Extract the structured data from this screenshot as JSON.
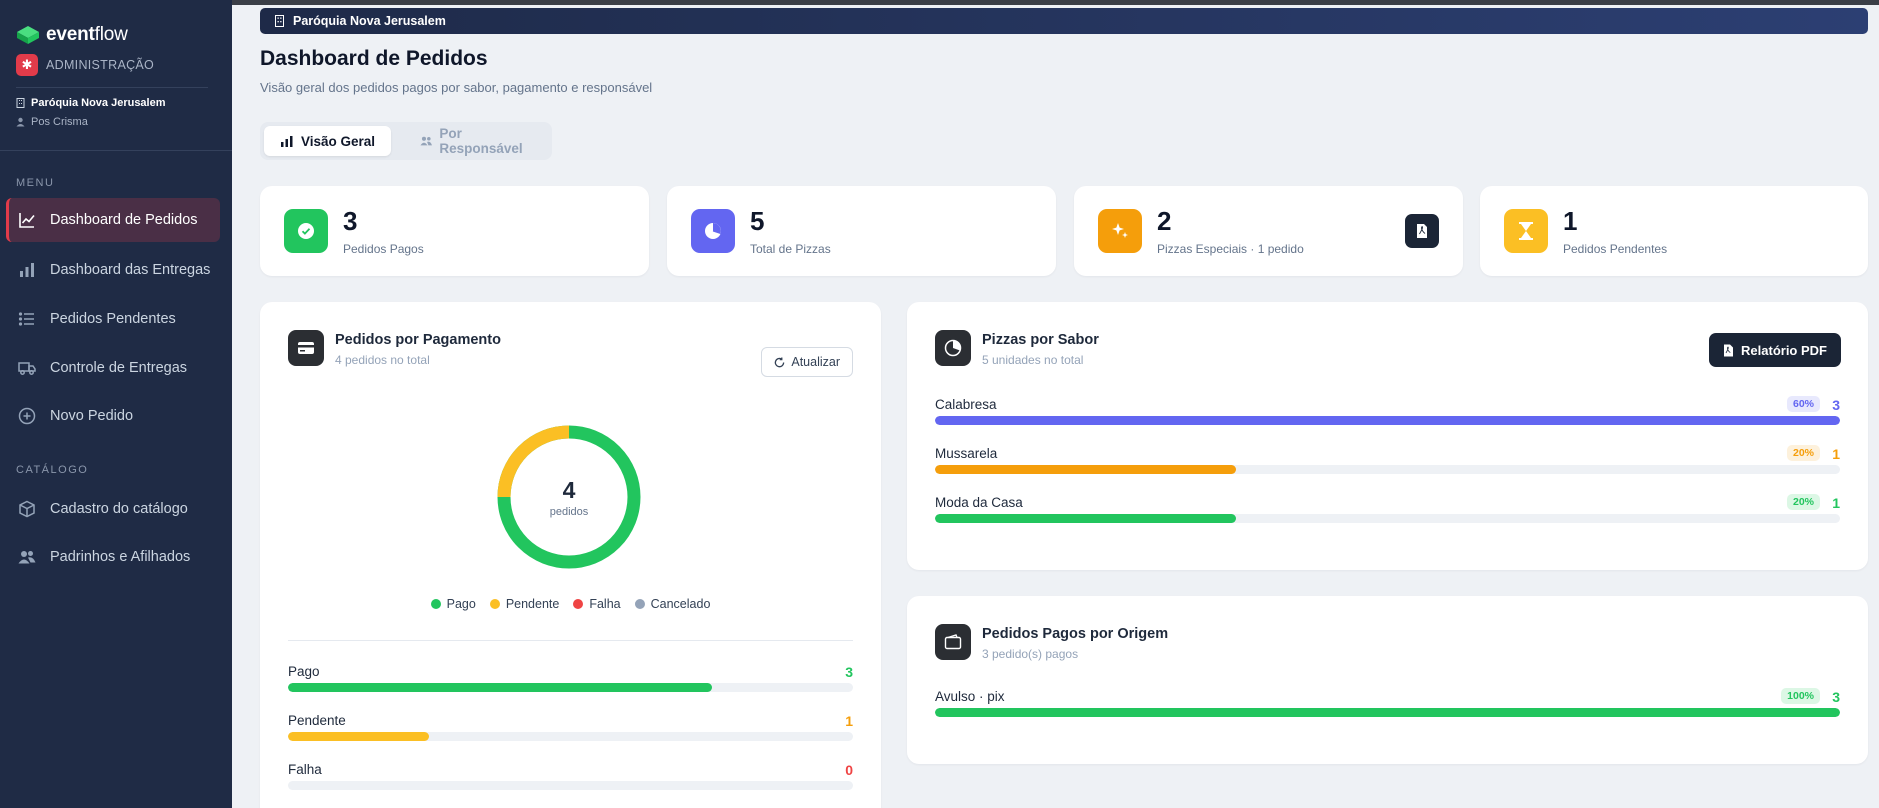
{
  "app": {
    "brand_bold": "event",
    "brand_rest": "flow",
    "admin_label": "ADMINISTRAÇÃO"
  },
  "sidebar": {
    "parish": "Paróquia Nova Jerusalem",
    "group": "Pos Crisma",
    "menu_header": "MENU",
    "catalog_header": "CATÁLOGO",
    "items": [
      {
        "label": "Dashboard de Pedidos",
        "icon": "line-chart-icon",
        "active": true
      },
      {
        "label": "Dashboard das Entregas",
        "icon": "bar-chart-icon"
      },
      {
        "label": "Pedidos Pendentes",
        "icon": "list-icon"
      },
      {
        "label": "Controle de Entregas",
        "icon": "truck-icon"
      },
      {
        "label": "Novo Pedido",
        "icon": "plus-circle-icon"
      }
    ],
    "catalog_items": [
      {
        "label": "Cadastro do catálogo",
        "icon": "box-icon"
      },
      {
        "label": "Padrinhos e Afilhados",
        "icon": "users-icon"
      }
    ]
  },
  "breadcrumb": "Paróquia Nova Jerusalem",
  "page": {
    "title": "Dashboard de Pedidos",
    "subtitle": "Visão geral dos pedidos pagos por sabor, pagamento e responsável"
  },
  "tabs": [
    {
      "label": "Visão Geral",
      "active": true
    },
    {
      "label": "Por Responsável",
      "active": false
    }
  ],
  "stats": [
    {
      "value": "3",
      "label": "Pedidos Pagos",
      "color": "#22c55e",
      "icon": "check-circle-icon"
    },
    {
      "value": "5",
      "label": "Total de Pizzas",
      "color": "#6366f1",
      "icon": "pie-chart-icon"
    },
    {
      "value": "2",
      "label": "Pizzas Especiais · 1 pedido",
      "color": "#f59e0b",
      "icon": "sparkles-icon"
    },
    {
      "value": "1",
      "label": "Pedidos Pendentes",
      "color": "#fbbf24",
      "icon": "hourglass-icon"
    }
  ],
  "payment": {
    "title": "Pedidos por Pagamento",
    "subtitle": "4 pedidos no total",
    "refresh_label": "Atualizar",
    "donut_total": "4",
    "donut_unit": "pedidos",
    "legend": [
      {
        "label": "Pago",
        "color": "#22c55e"
      },
      {
        "label": "Pendente",
        "color": "#fbbf24"
      },
      {
        "label": "Falha",
        "color": "#ef4444"
      },
      {
        "label": "Cancelado",
        "color": "#94a3b8"
      }
    ],
    "rows": [
      {
        "label": "Pago",
        "count": "3",
        "value": 3,
        "color": "#22c55e"
      },
      {
        "label": "Pendente",
        "count": "1",
        "value": 1,
        "color": "#fbbf24",
        "count_color": "#f59e0b"
      },
      {
        "label": "Falha",
        "count": "0",
        "value": 0,
        "color": "#ef4444"
      }
    ],
    "max": 4
  },
  "flavors": {
    "title": "Pizzas por Sabor",
    "subtitle": "5 unidades no total",
    "pdf_label": "Relatório PDF",
    "rows": [
      {
        "label": "Calabresa",
        "pct": "60%",
        "count": "3",
        "fraction": 1.0,
        "color": "#6366f1",
        "pct_bg": "#e8e9fd"
      },
      {
        "label": "Mussarela",
        "pct": "20%",
        "count": "1",
        "fraction": 0.333,
        "color": "#f59e0b",
        "pct_bg": "#fdf1dc"
      },
      {
        "label": "Moda da Casa",
        "pct": "20%",
        "count": "1",
        "fraction": 0.333,
        "color": "#22c55e",
        "pct_bg": "#dcf7e5"
      }
    ]
  },
  "origin": {
    "title": "Pedidos Pagos por Origem",
    "subtitle": "3 pedido(s) pagos",
    "rows": [
      {
        "label": "Avulso · pix",
        "pct": "100%",
        "count": "3",
        "fraction": 1.0,
        "color": "#22c55e",
        "pct_bg": "#dcf7e5"
      }
    ]
  }
}
